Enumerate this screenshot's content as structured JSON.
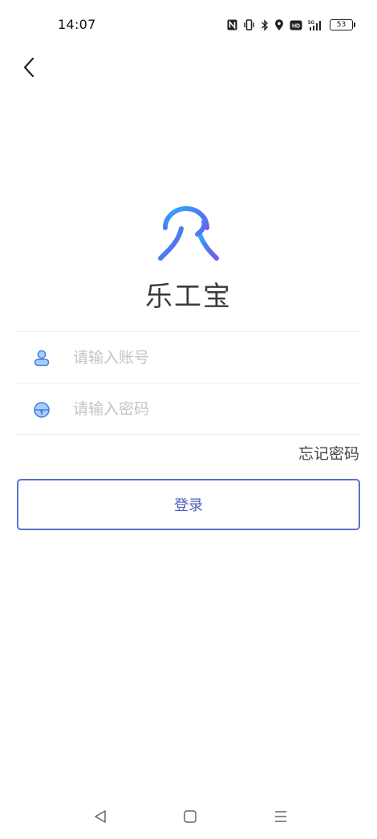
{
  "status_bar": {
    "time": "14:07",
    "battery_level": "53",
    "icons": [
      "nfc-icon",
      "vibrate-icon",
      "bluetooth-icon",
      "location-icon",
      "hd-icon",
      "5g-signal-icon",
      "battery-icon"
    ]
  },
  "header": {
    "back_icon": "chevron-left-icon"
  },
  "app": {
    "name": "乐工宝",
    "logo_colors": [
      "#2fa8ff",
      "#4a7df0",
      "#7a5cf0"
    ]
  },
  "login_form": {
    "account": {
      "placeholder": "请输入账号",
      "value": "",
      "icon": "user-icon"
    },
    "password": {
      "placeholder": "请输入密码",
      "value": "",
      "icon": "lock-icon"
    },
    "forgot_password_label": "忘记密码",
    "login_button_label": "登录",
    "accent_color": "#5b72c8"
  },
  "nav_bar": {
    "back": "back-triangle-icon",
    "home": "home-square-icon",
    "menu": "menu-lines-icon"
  }
}
